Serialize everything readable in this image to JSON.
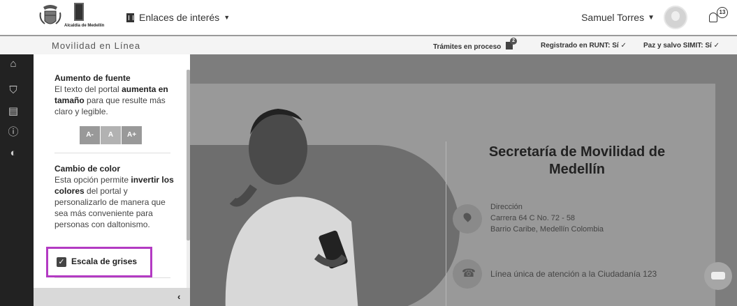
{
  "header": {
    "logo_text": "Alcaldía de Medellín",
    "links_label": "Enlaces de interés",
    "user_name": "Samuel Torres",
    "notification_count": "13"
  },
  "subbar": {
    "title": "Movilidad en Línea",
    "tramites": "Trámites en proceso",
    "tramites_count": "2",
    "runt": "Registrado en RUNT: Sí ✓",
    "simit": "Paz y salvo SIMIT: Sí ✓"
  },
  "panel": {
    "font_title": "Aumento de fuente",
    "font_text_1": "El texto del portal ",
    "font_text_bold": "aumenta en tamaño",
    "font_text_2": " para que resulte más claro y legible.",
    "font_buttons": [
      "A-",
      "A",
      "A+"
    ],
    "color_title": "Cambio de color",
    "color_text_1": "Esta opción permite ",
    "color_text_bold": "invertir los colores",
    "color_text_2": " del portal y personalizarlo de manera que sea más conveniente para personas con daltonismo.",
    "grayscale_label": "Escala de grises",
    "grayscale_checked": true,
    "collapse_icon": "‹"
  },
  "content": {
    "title": "Secretaría de Movilidad de Medellín",
    "address_label": "Dirección",
    "address_line1": "Carrera 64 C No. 72 - 58",
    "address_line2": "Barrio Caribe, Medellín Colombia",
    "phone_line": "Línea única de atención a la Ciudadanía 123"
  }
}
